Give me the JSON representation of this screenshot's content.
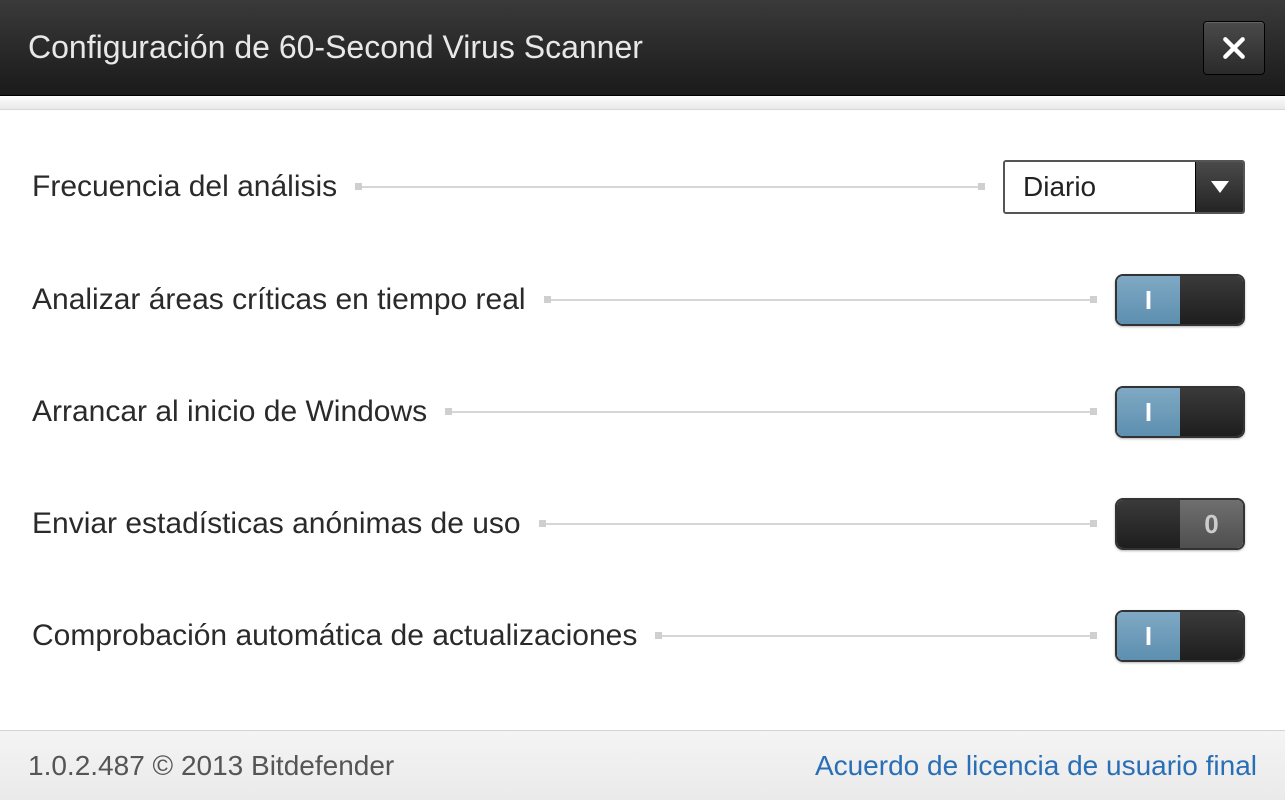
{
  "titlebar": {
    "title": "Configuración de 60-Second Virus Scanner"
  },
  "settings": {
    "scan_frequency": {
      "label": "Frecuencia del análisis",
      "selected": "Diario"
    },
    "realtime_scan": {
      "label": "Analizar áreas críticas en tiempo real",
      "state": "on",
      "on_glyph": "I",
      "off_glyph": "0"
    },
    "start_with_windows": {
      "label": "Arrancar al inicio de Windows",
      "state": "on",
      "on_glyph": "I",
      "off_glyph": "0"
    },
    "anonymous_stats": {
      "label": "Enviar estadísticas anónimas de uso",
      "state": "off",
      "on_glyph": "I",
      "off_glyph": "0"
    },
    "auto_update_check": {
      "label": "Comprobación automática de actualizaciones",
      "state": "on",
      "on_glyph": "I",
      "off_glyph": "0"
    }
  },
  "footer": {
    "version_copyright": "1.0.2.487 © 2013 Bitdefender",
    "eula_link": "Acuerdo de licencia de usuario final"
  }
}
